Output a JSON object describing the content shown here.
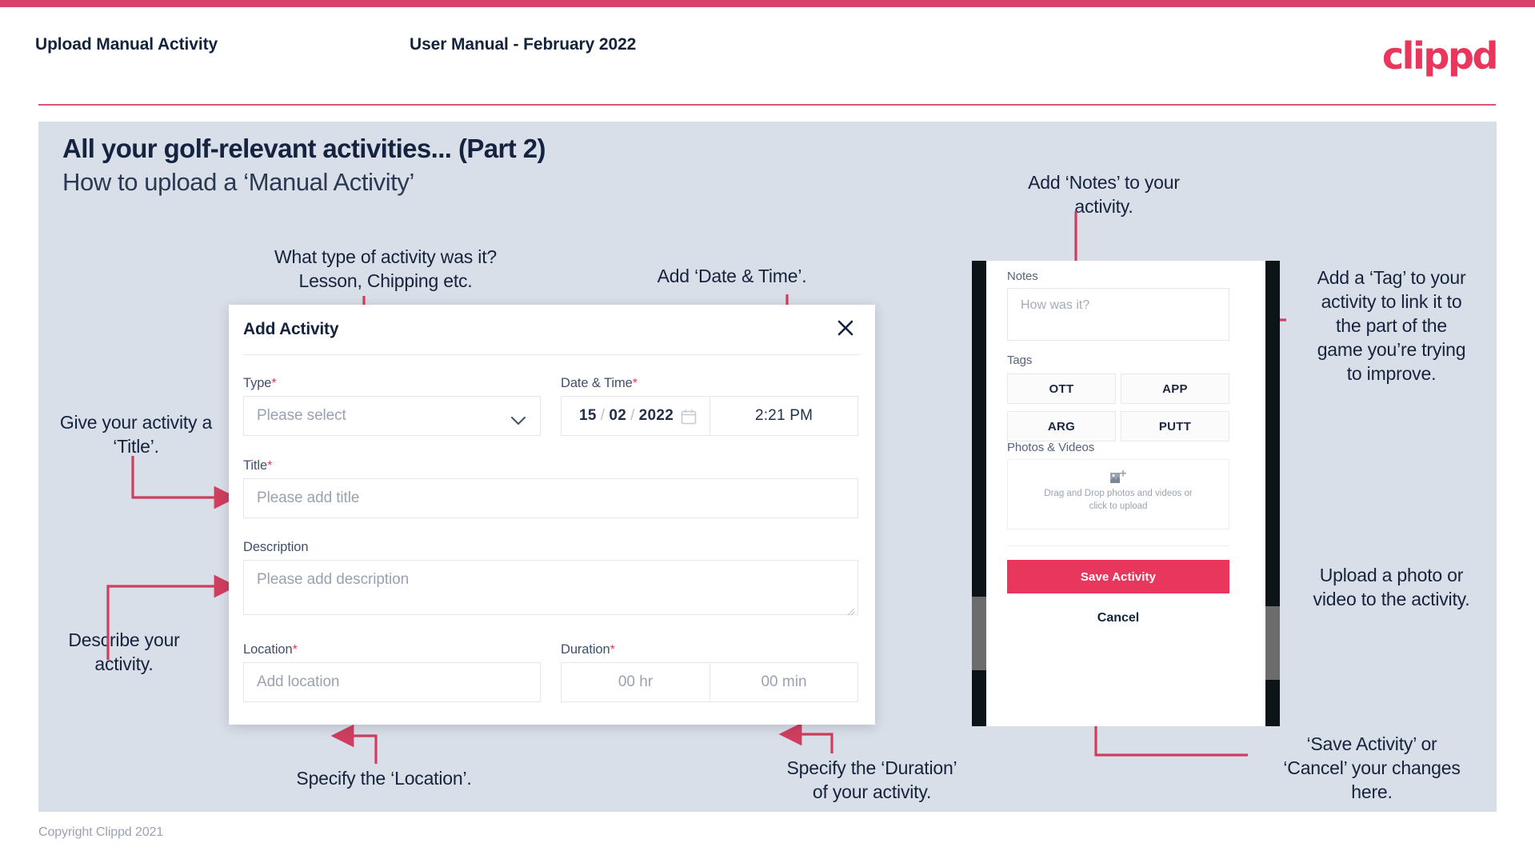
{
  "header": {
    "left_title": "Upload Manual Activity",
    "center_title": "User Manual - February 2022",
    "logo": "clippd",
    "accent_color": "#d9436a"
  },
  "slide": {
    "title": "All your golf-relevant activities... (Part 2)",
    "subtitle": "How to upload a ‘Manual Activity’",
    "background": "#d9dfe8"
  },
  "annotations": {
    "type": "What type of activity was it?\nLesson, Chipping etc.",
    "type_line1": "What type of activity was it?",
    "type_line2": "Lesson, Chipping etc.",
    "datetime": "Add ‘Date & Time’.",
    "title_field_line1": "Give your activity a",
    "title_field_line2": "‘Title’.",
    "description_line1": "Describe your",
    "description_line2": "activity.",
    "location": "Specify the ‘Location’.",
    "duration_line1": "Specify the ‘Duration’",
    "duration_line2": "of your activity.",
    "notes_line1": "Add ‘Notes’ to your",
    "notes_line2": "activity.",
    "tags_line1": "Add a ‘Tag’ to your",
    "tags_line2": "activity to link it to",
    "tags_line3": "the part of the",
    "tags_line4": "game you’re trying",
    "tags_line5": "to improve.",
    "photos_line1": "Upload a photo or",
    "photos_line2": "video to the activity.",
    "save_line1": "‘Save Activity’ or",
    "save_line2": "‘Cancel’ your changes",
    "save_line3": "here.",
    "arrow_color": "#cf3e5f"
  },
  "modal": {
    "title": "Add Activity",
    "close_icon": "close-icon",
    "fields": {
      "type": {
        "label": "Type",
        "required": "*",
        "placeholder": "Please select",
        "icon": "chevron-down-icon"
      },
      "datetime": {
        "label": "Date & Time",
        "required": "*",
        "day": "15",
        "month": "02",
        "year": "2022",
        "separator": "/",
        "time": "2:21 PM",
        "icon": "calendar-icon"
      },
      "title": {
        "label": "Title",
        "required": "*",
        "placeholder": "Please add title"
      },
      "description": {
        "label": "Description",
        "required": "",
        "placeholder": "Please add description"
      },
      "location": {
        "label": "Location",
        "required": "*",
        "placeholder": "Add location"
      },
      "duration": {
        "label": "Duration",
        "required": "*",
        "hours_placeholder": "00 hr",
        "minutes_placeholder": "00 min"
      }
    }
  },
  "phone": {
    "notes": {
      "label": "Notes",
      "placeholder": "How was it?"
    },
    "tags": {
      "label": "Tags",
      "items": [
        "OTT",
        "APP",
        "ARG",
        "PUTT"
      ]
    },
    "photos": {
      "label": "Photos & Videos",
      "drop_line1": "Drag and Drop photos and videos or",
      "drop_line2": "click to upload",
      "icon": "add-image-icon"
    },
    "save_label": "Save Activity",
    "cancel_label": "Cancel",
    "save_color": "#e8365d"
  },
  "footer": {
    "copyright": "Copyright Clippd 2021"
  }
}
